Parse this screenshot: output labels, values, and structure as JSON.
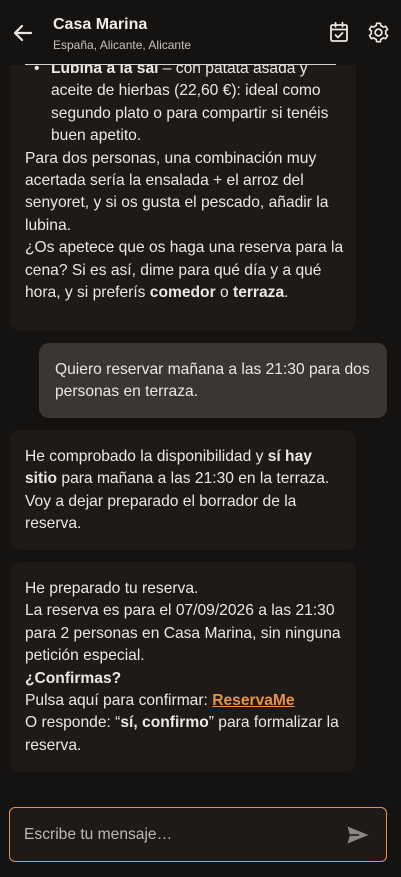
{
  "header": {
    "title": "Casa Marina",
    "subtitle": "España, Alicante, Alicante",
    "icons": {
      "back": "arrow-left-icon",
      "calendar": "calendar-check-icon",
      "settings": "gear-icon"
    }
  },
  "messages": {
    "m1": {
      "item_title": "Lubina a la sal",
      "item_text": " – con patata asada y aceite de hierbas (22,60 €): ideal como segundo plato o para compartir si tenéis buen apetito.",
      "p1": "Para dos personas, una combinación muy acertada sería la ensalada + el arroz del senyoret, y si os gusta el pescado, añadir la lubina.",
      "p2_pre": "¿Os apetece que os haga una reserva para la cena? Si es así, dime para qué día y a qué hora, y si preferís ",
      "p2_b1": "comedor",
      "p2_mid": " o ",
      "p2_b2": "terraza",
      "p2_end": "."
    },
    "m2": {
      "text": "Quiero reservar mañana a las 21:30 para dos personas en terraza."
    },
    "m3": {
      "pre": "He comprobado la disponibilidad y ",
      "bold": "sí hay sitio",
      "post": " para mañana a las 21:30 en la terraza. Voy a dejar preparado el borrador de la reserva."
    },
    "m4": {
      "l1": "He preparado tu reserva.",
      "l2": "La reserva es para el 07/09/2026 a las 21:30 para 2 personas en Casa Marina, sin ninguna petición especial.",
      "l3": "¿Confirmas?",
      "l4_pre": "Pulsa aquí para confirmar: ",
      "l4_link": "ReservaMe",
      "l5_pre": "O responde: “",
      "l5_bold": "sí, confirmo",
      "l5_post": "” para formalizar la reserva."
    }
  },
  "composer": {
    "placeholder": "Escribe tu mensaje…",
    "icon": "send-icon"
  },
  "colors": {
    "accent": "#e8914a",
    "background": "#151312",
    "bot_bubble": "#1d1a18",
    "user_bubble": "#3b3632"
  }
}
